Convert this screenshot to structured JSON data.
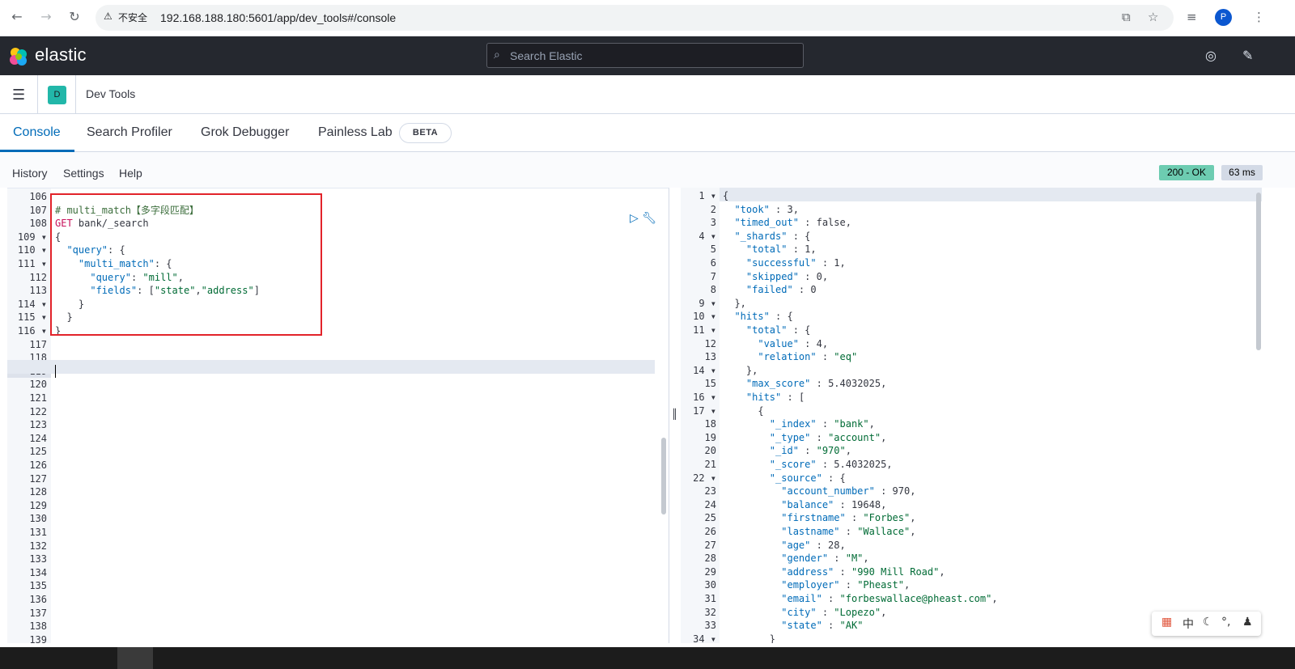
{
  "browser": {
    "url": "192.168.188.180:5601/app/dev_tools#/console",
    "security_warning": "不安全",
    "avatar_letter": "P"
  },
  "header": {
    "brand": "elastic",
    "search_placeholder": "Search Elastic"
  },
  "breadcrumb": {
    "space_letter": "D",
    "title": "Dev Tools"
  },
  "tabs": [
    {
      "label": "Console",
      "active": true
    },
    {
      "label": "Search Profiler"
    },
    {
      "label": "Grok Debugger"
    },
    {
      "label": "Painless Lab"
    }
  ],
  "beta_label": "BETA",
  "toolbar": {
    "history": "History",
    "settings": "Settings",
    "help": "Help",
    "status": "200 - OK",
    "time": "63 ms"
  },
  "editor": {
    "first_line": 106,
    "last_line": 139,
    "cursor_line": 119,
    "lines": [
      {
        "n": 106,
        "text": ""
      },
      {
        "n": 107,
        "text": "# multi_match【多字段匹配】"
      },
      {
        "n": 108,
        "text": "GET bank/_search"
      },
      {
        "n": 109,
        "text": "{"
      },
      {
        "n": 110,
        "text": "  \"query\": {"
      },
      {
        "n": 111,
        "text": "    \"multi_match\": {"
      },
      {
        "n": 112,
        "text": "      \"query\": \"mill\","
      },
      {
        "n": 113,
        "text": "      \"fields\": [\"state\",\"address\"]"
      },
      {
        "n": 114,
        "text": "    }"
      },
      {
        "n": 115,
        "text": "  }"
      },
      {
        "n": 116,
        "text": "}"
      }
    ]
  },
  "output": {
    "lines": [
      "{",
      "  \"took\" : 3,",
      "  \"timed_out\" : false,",
      "  \"_shards\" : {",
      "    \"total\" : 1,",
      "    \"successful\" : 1,",
      "    \"skipped\" : 0,",
      "    \"failed\" : 0",
      "  },",
      "  \"hits\" : {",
      "    \"total\" : {",
      "      \"value\" : 4,",
      "      \"relation\" : \"eq\"",
      "    },",
      "    \"max_score\" : 5.4032025,",
      "    \"hits\" : [",
      "      {",
      "        \"_index\" : \"bank\",",
      "        \"_type\" : \"account\",",
      "        \"_id\" : \"970\",",
      "        \"_score\" : 5.4032025,",
      "        \"_source\" : {",
      "          \"account_number\" : 970,",
      "          \"balance\" : 19648,",
      "          \"firstname\" : \"Forbes\",",
      "          \"lastname\" : \"Wallace\",",
      "          \"age\" : 28,",
      "          \"gender\" : \"M\",",
      "          \"address\" : \"990 Mill Road\",",
      "          \"employer\" : \"Pheast\",",
      "          \"email\" : \"forbeswallace@pheast.com\",",
      "          \"city\" : \"Lopezo\",",
      "          \"state\" : \"AK\"",
      "        }"
    ],
    "fold_lines": [
      1,
      4,
      9,
      10,
      11,
      14,
      16,
      17,
      22,
      34
    ]
  },
  "ime": {
    "label": "中"
  },
  "colors": {
    "accent": "#006bb8",
    "header_bg": "#25282f",
    "status_ok": "#6dccb1",
    "highlight_box": "#e2232a"
  }
}
